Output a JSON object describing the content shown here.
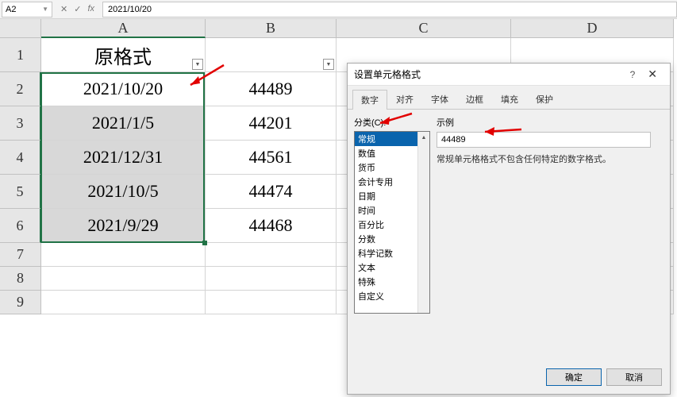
{
  "formula_bar": {
    "name_box": "A2",
    "fx_label": "fx",
    "value": "2021/10/20"
  },
  "columns": [
    "A",
    "B",
    "C",
    "D"
  ],
  "rows": [
    "1",
    "2",
    "3",
    "4",
    "5",
    "6",
    "7",
    "8",
    "9"
  ],
  "sheet": {
    "header_a": "原格式",
    "col_a": [
      "2021/10/20",
      "2021/1/5",
      "2021/12/31",
      "2021/10/5",
      "2021/9/29"
    ],
    "col_b": [
      "44489",
      "44201",
      "44561",
      "44474",
      "44468"
    ]
  },
  "dialog": {
    "title": "设置单元格格式",
    "help": "?",
    "close": "✕",
    "tabs": [
      "数字",
      "对齐",
      "字体",
      "边框",
      "填充",
      "保护"
    ],
    "category_label": "分类(C):",
    "categories": [
      "常规",
      "数值",
      "货币",
      "会计专用",
      "日期",
      "时间",
      "百分比",
      "分数",
      "科学记数",
      "文本",
      "特殊",
      "自定义"
    ],
    "example_label": "示例",
    "example_value": "44489",
    "hint": "常规单元格格式不包含任何特定的数字格式。",
    "ok": "确定",
    "cancel": "取消"
  }
}
